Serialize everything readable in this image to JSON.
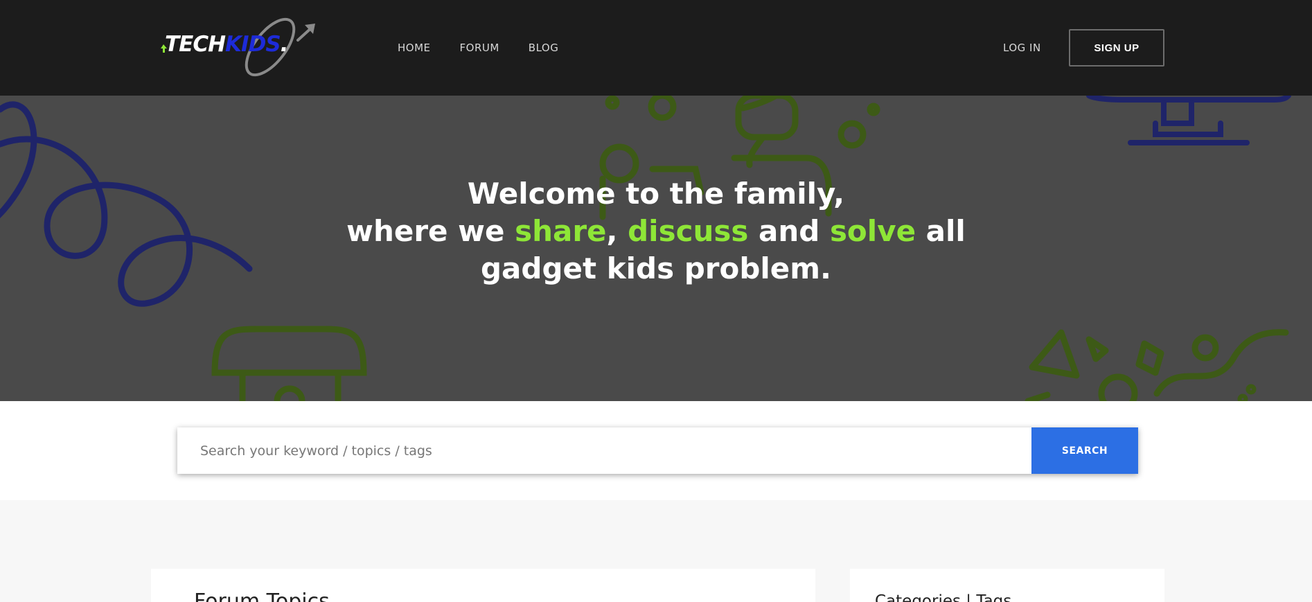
{
  "header": {
    "logo": {
      "part1": "TECH",
      "part2": "KIDS",
      "part3": "."
    },
    "nav": [
      {
        "label": "HOME"
      },
      {
        "label": "FORUM"
      },
      {
        "label": "BLOG"
      }
    ],
    "login_label": "LOG IN",
    "signup_label": "SIGN UP"
  },
  "hero": {
    "line1": "Welcome to the family,",
    "line2_pre": "where we ",
    "word_share": "share",
    "sep1": ", ",
    "word_discuss": "discuss",
    "sep2": " and ",
    "word_solve": "solve",
    "line2_post": " all",
    "line3": "gadget kids problem."
  },
  "search": {
    "placeholder": "Search your keyword / topics / tags",
    "button_label": "SEARCH"
  },
  "cards": {
    "forum_title": "Forum Topics",
    "categories_title": "Categories | Tags"
  },
  "colors": {
    "header_bg": "#1c1c1c",
    "hero_bg": "#4a4a4a",
    "highlight_green": "#8ee637",
    "search_blue": "#2c6fe4",
    "deco_navy": "#1f2469",
    "deco_olive": "#3d5a16"
  }
}
